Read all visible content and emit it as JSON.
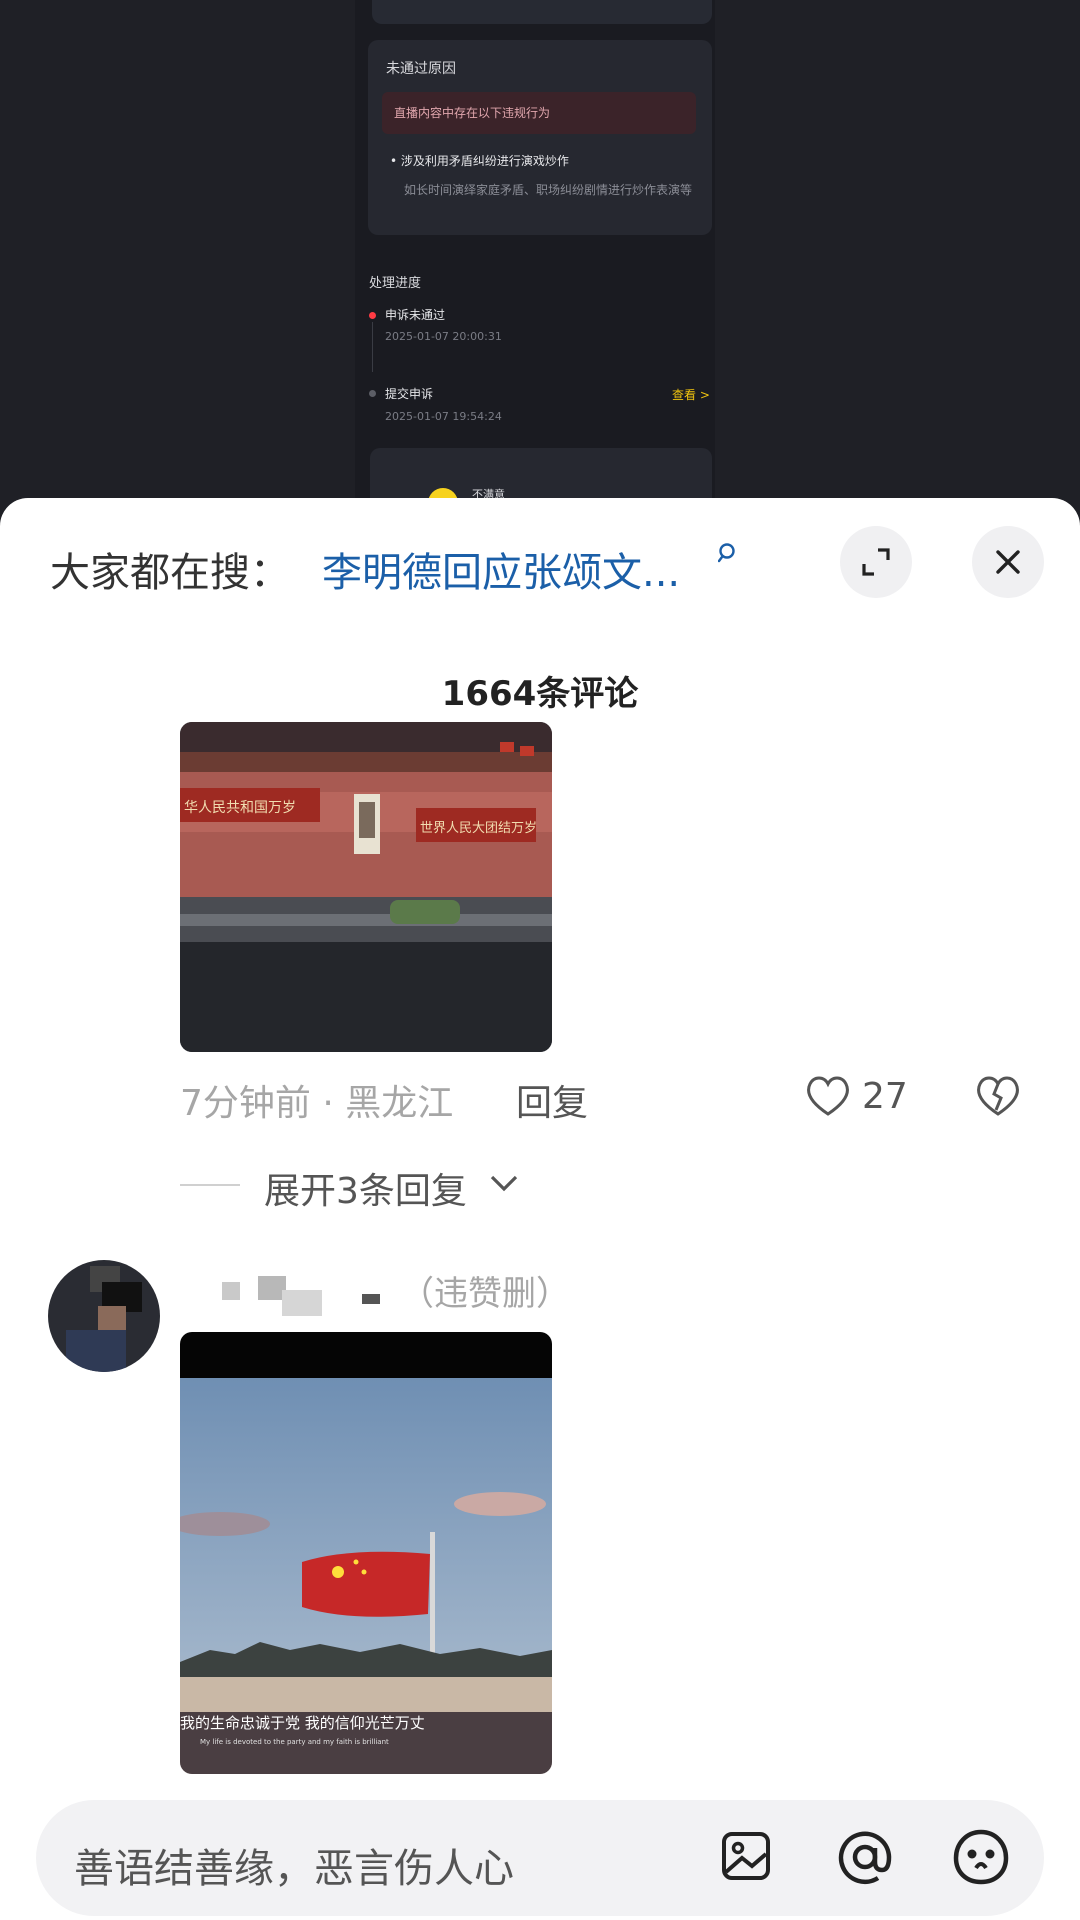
{
  "background": {
    "reason_card": {
      "title": "未通过原因",
      "banner": "直播内容中存在以下违规行为",
      "item": "• 涉及利用矛盾纠纷进行演戏炒作",
      "description": "如长时间演绎家庭矛盾、职场纠纷剧情进行炒作表演等"
    },
    "progress": {
      "title": "处理进度",
      "steps": [
        {
          "title": "申诉未通过",
          "time": "2025-01-07 20:00:31"
        },
        {
          "title": "提交申诉",
          "time": "2025-01-07 19:54:24"
        }
      ],
      "view_link": "查看 >"
    },
    "feedback": {
      "label": "不满意"
    }
  },
  "sheet": {
    "search": {
      "prefix": "大家都在搜：",
      "query": "李明德回应张颂文...",
      "icon": "search-icon"
    },
    "comment_count": "1664条评论",
    "comment1": {
      "photo_banner_left": "华人民共和国万岁",
      "photo_banner_right": "世界人民大团结万岁",
      "time_location": "7分钟前 · 黑龙江",
      "reply": "回复",
      "likes": "27",
      "expand_replies": "展开3条回复"
    },
    "comment2": {
      "username_suffix": "（违赞删）",
      "photo_caption": "我的生命忠诚于党 我的信仰光芒万丈",
      "photo_caption_en": "My life is devoted to the party and my faith is brilliant"
    },
    "input": {
      "placeholder": "善语结善缘，恶言伤人心",
      "icons": [
        "image-icon",
        "at-icon",
        "emoji-icon"
      ]
    }
  },
  "colors": {
    "accent_link": "#1b5fa8",
    "like_gray": "#555555",
    "dark_bg": "#1f2026",
    "alert_red": "#ff3b44",
    "view_yellow": "#f1c40f"
  }
}
